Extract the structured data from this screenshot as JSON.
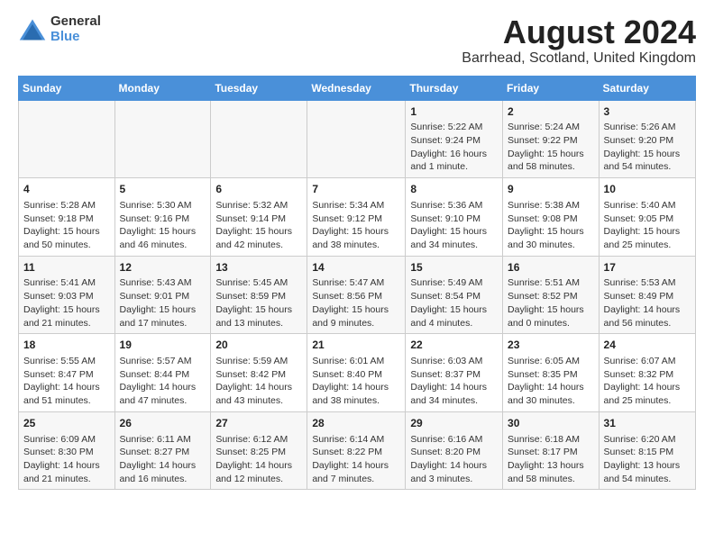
{
  "logo": {
    "general": "General",
    "blue": "Blue"
  },
  "title": "August 2024",
  "subtitle": "Barrhead, Scotland, United Kingdom",
  "days_of_week": [
    "Sunday",
    "Monday",
    "Tuesday",
    "Wednesday",
    "Thursday",
    "Friday",
    "Saturday"
  ],
  "weeks": [
    [
      {
        "day": "",
        "content": ""
      },
      {
        "day": "",
        "content": ""
      },
      {
        "day": "",
        "content": ""
      },
      {
        "day": "",
        "content": ""
      },
      {
        "day": "1",
        "content": "Sunrise: 5:22 AM\nSunset: 9:24 PM\nDaylight: 16 hours and 1 minute."
      },
      {
        "day": "2",
        "content": "Sunrise: 5:24 AM\nSunset: 9:22 PM\nDaylight: 15 hours and 58 minutes."
      },
      {
        "day": "3",
        "content": "Sunrise: 5:26 AM\nSunset: 9:20 PM\nDaylight: 15 hours and 54 minutes."
      }
    ],
    [
      {
        "day": "4",
        "content": "Sunrise: 5:28 AM\nSunset: 9:18 PM\nDaylight: 15 hours and 50 minutes."
      },
      {
        "day": "5",
        "content": "Sunrise: 5:30 AM\nSunset: 9:16 PM\nDaylight: 15 hours and 46 minutes."
      },
      {
        "day": "6",
        "content": "Sunrise: 5:32 AM\nSunset: 9:14 PM\nDaylight: 15 hours and 42 minutes."
      },
      {
        "day": "7",
        "content": "Sunrise: 5:34 AM\nSunset: 9:12 PM\nDaylight: 15 hours and 38 minutes."
      },
      {
        "day": "8",
        "content": "Sunrise: 5:36 AM\nSunset: 9:10 PM\nDaylight: 15 hours and 34 minutes."
      },
      {
        "day": "9",
        "content": "Sunrise: 5:38 AM\nSunset: 9:08 PM\nDaylight: 15 hours and 30 minutes."
      },
      {
        "day": "10",
        "content": "Sunrise: 5:40 AM\nSunset: 9:05 PM\nDaylight: 15 hours and 25 minutes."
      }
    ],
    [
      {
        "day": "11",
        "content": "Sunrise: 5:41 AM\nSunset: 9:03 PM\nDaylight: 15 hours and 21 minutes."
      },
      {
        "day": "12",
        "content": "Sunrise: 5:43 AM\nSunset: 9:01 PM\nDaylight: 15 hours and 17 minutes."
      },
      {
        "day": "13",
        "content": "Sunrise: 5:45 AM\nSunset: 8:59 PM\nDaylight: 15 hours and 13 minutes."
      },
      {
        "day": "14",
        "content": "Sunrise: 5:47 AM\nSunset: 8:56 PM\nDaylight: 15 hours and 9 minutes."
      },
      {
        "day": "15",
        "content": "Sunrise: 5:49 AM\nSunset: 8:54 PM\nDaylight: 15 hours and 4 minutes."
      },
      {
        "day": "16",
        "content": "Sunrise: 5:51 AM\nSunset: 8:52 PM\nDaylight: 15 hours and 0 minutes."
      },
      {
        "day": "17",
        "content": "Sunrise: 5:53 AM\nSunset: 8:49 PM\nDaylight: 14 hours and 56 minutes."
      }
    ],
    [
      {
        "day": "18",
        "content": "Sunrise: 5:55 AM\nSunset: 8:47 PM\nDaylight: 14 hours and 51 minutes."
      },
      {
        "day": "19",
        "content": "Sunrise: 5:57 AM\nSunset: 8:44 PM\nDaylight: 14 hours and 47 minutes."
      },
      {
        "day": "20",
        "content": "Sunrise: 5:59 AM\nSunset: 8:42 PM\nDaylight: 14 hours and 43 minutes."
      },
      {
        "day": "21",
        "content": "Sunrise: 6:01 AM\nSunset: 8:40 PM\nDaylight: 14 hours and 38 minutes."
      },
      {
        "day": "22",
        "content": "Sunrise: 6:03 AM\nSunset: 8:37 PM\nDaylight: 14 hours and 34 minutes."
      },
      {
        "day": "23",
        "content": "Sunrise: 6:05 AM\nSunset: 8:35 PM\nDaylight: 14 hours and 30 minutes."
      },
      {
        "day": "24",
        "content": "Sunrise: 6:07 AM\nSunset: 8:32 PM\nDaylight: 14 hours and 25 minutes."
      }
    ],
    [
      {
        "day": "25",
        "content": "Sunrise: 6:09 AM\nSunset: 8:30 PM\nDaylight: 14 hours and 21 minutes."
      },
      {
        "day": "26",
        "content": "Sunrise: 6:11 AM\nSunset: 8:27 PM\nDaylight: 14 hours and 16 minutes."
      },
      {
        "day": "27",
        "content": "Sunrise: 6:12 AM\nSunset: 8:25 PM\nDaylight: 14 hours and 12 minutes."
      },
      {
        "day": "28",
        "content": "Sunrise: 6:14 AM\nSunset: 8:22 PM\nDaylight: 14 hours and 7 minutes."
      },
      {
        "day": "29",
        "content": "Sunrise: 6:16 AM\nSunset: 8:20 PM\nDaylight: 14 hours and 3 minutes."
      },
      {
        "day": "30",
        "content": "Sunrise: 6:18 AM\nSunset: 8:17 PM\nDaylight: 13 hours and 58 minutes."
      },
      {
        "day": "31",
        "content": "Sunrise: 6:20 AM\nSunset: 8:15 PM\nDaylight: 13 hours and 54 minutes."
      }
    ]
  ]
}
